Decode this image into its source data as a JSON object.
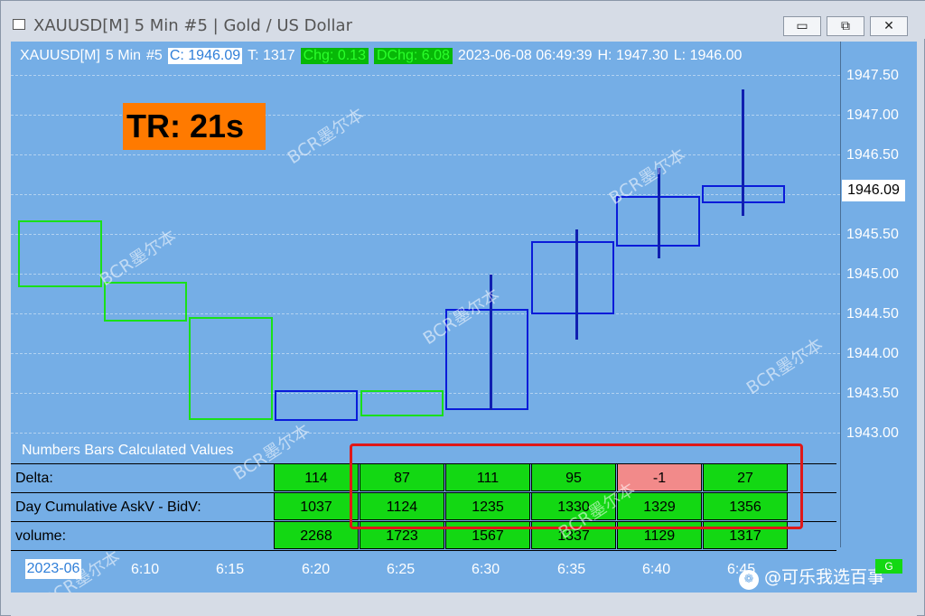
{
  "window": {
    "title": "XAUUSD[M]   5 Min   #5 | Gold / US Dollar",
    "buttons": {
      "minimize": "▭",
      "restore": "⧉",
      "close": "✕"
    }
  },
  "header": {
    "symbol": "XAUUSD[M]",
    "interval": "5 Min",
    "slot": "#5",
    "close": "C: 1946.09",
    "ticks": "T: 1317",
    "change": "Chg: 0.13",
    "day_change": "DChg: 6.08",
    "datetime": "2023-06-08 06:49:39",
    "high": "H: 1947.30",
    "low": "L: 1946.00"
  },
  "timer": "TR: 21s",
  "price_axis": {
    "labels": [
      "1947.50",
      "1947.00",
      "1946.50",
      "1946.00",
      "1945.50",
      "1945.00",
      "1944.50",
      "1944.00",
      "1943.50",
      "1943.00"
    ],
    "current": "1946.09"
  },
  "time_axis": {
    "date": "2023-06",
    "ticks": [
      "6:10",
      "6:15",
      "6:20",
      "6:25",
      "6:30",
      "6:35",
      "6:40",
      "6:45"
    ]
  },
  "panel": {
    "title": "Numbers Bars Calculated Values",
    "rows": [
      {
        "label": "Delta:",
        "values": [
          "114",
          "87",
          "111",
          "95",
          "-1",
          "27"
        ]
      },
      {
        "label": "Day Cumulative AskV - BidV:",
        "values": [
          "1037",
          "1124",
          "1235",
          "1330",
          "1329",
          "1356"
        ]
      },
      {
        "label": "volume:",
        "values": [
          "2268",
          "1723",
          "1567",
          "1337",
          "1129",
          "1317"
        ]
      }
    ]
  },
  "watermark_text": "BCR墨尔本",
  "brand": "@可乐我选百事",
  "status_badge": "G"
}
